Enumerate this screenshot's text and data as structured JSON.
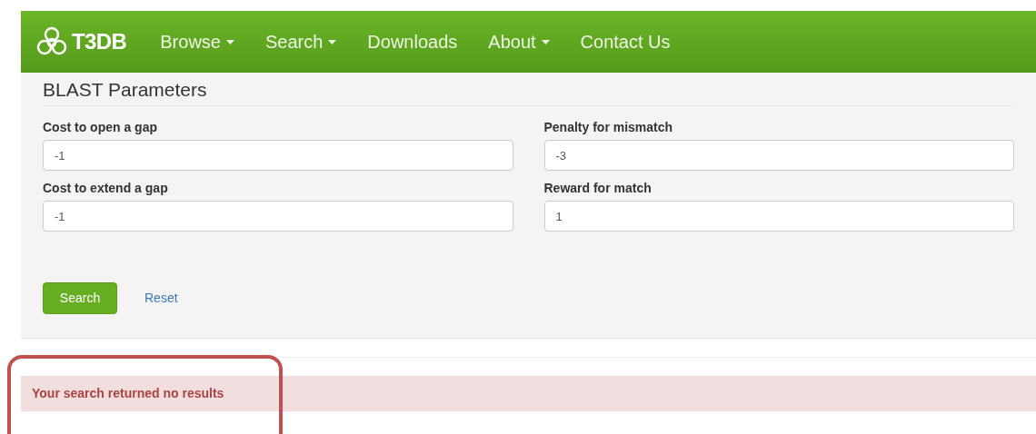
{
  "navbar": {
    "brand": "T3DB",
    "items": [
      {
        "label": "Browse",
        "dropdown": true
      },
      {
        "label": "Search",
        "dropdown": true
      },
      {
        "label": "Downloads",
        "dropdown": false
      },
      {
        "label": "About",
        "dropdown": true
      },
      {
        "label": "Contact Us",
        "dropdown": false
      }
    ]
  },
  "panel": {
    "title": "BLAST Parameters",
    "fields": [
      {
        "label": "Cost to open a gap",
        "value": "-1"
      },
      {
        "label": "Penalty for mismatch",
        "value": "-3"
      },
      {
        "label": "Cost to extend a gap",
        "value": "-1"
      },
      {
        "label": "Reward for match",
        "value": "1"
      }
    ],
    "search_button": "Search",
    "reset_link": "Reset"
  },
  "alert": {
    "message": "Your search returned no results"
  }
}
